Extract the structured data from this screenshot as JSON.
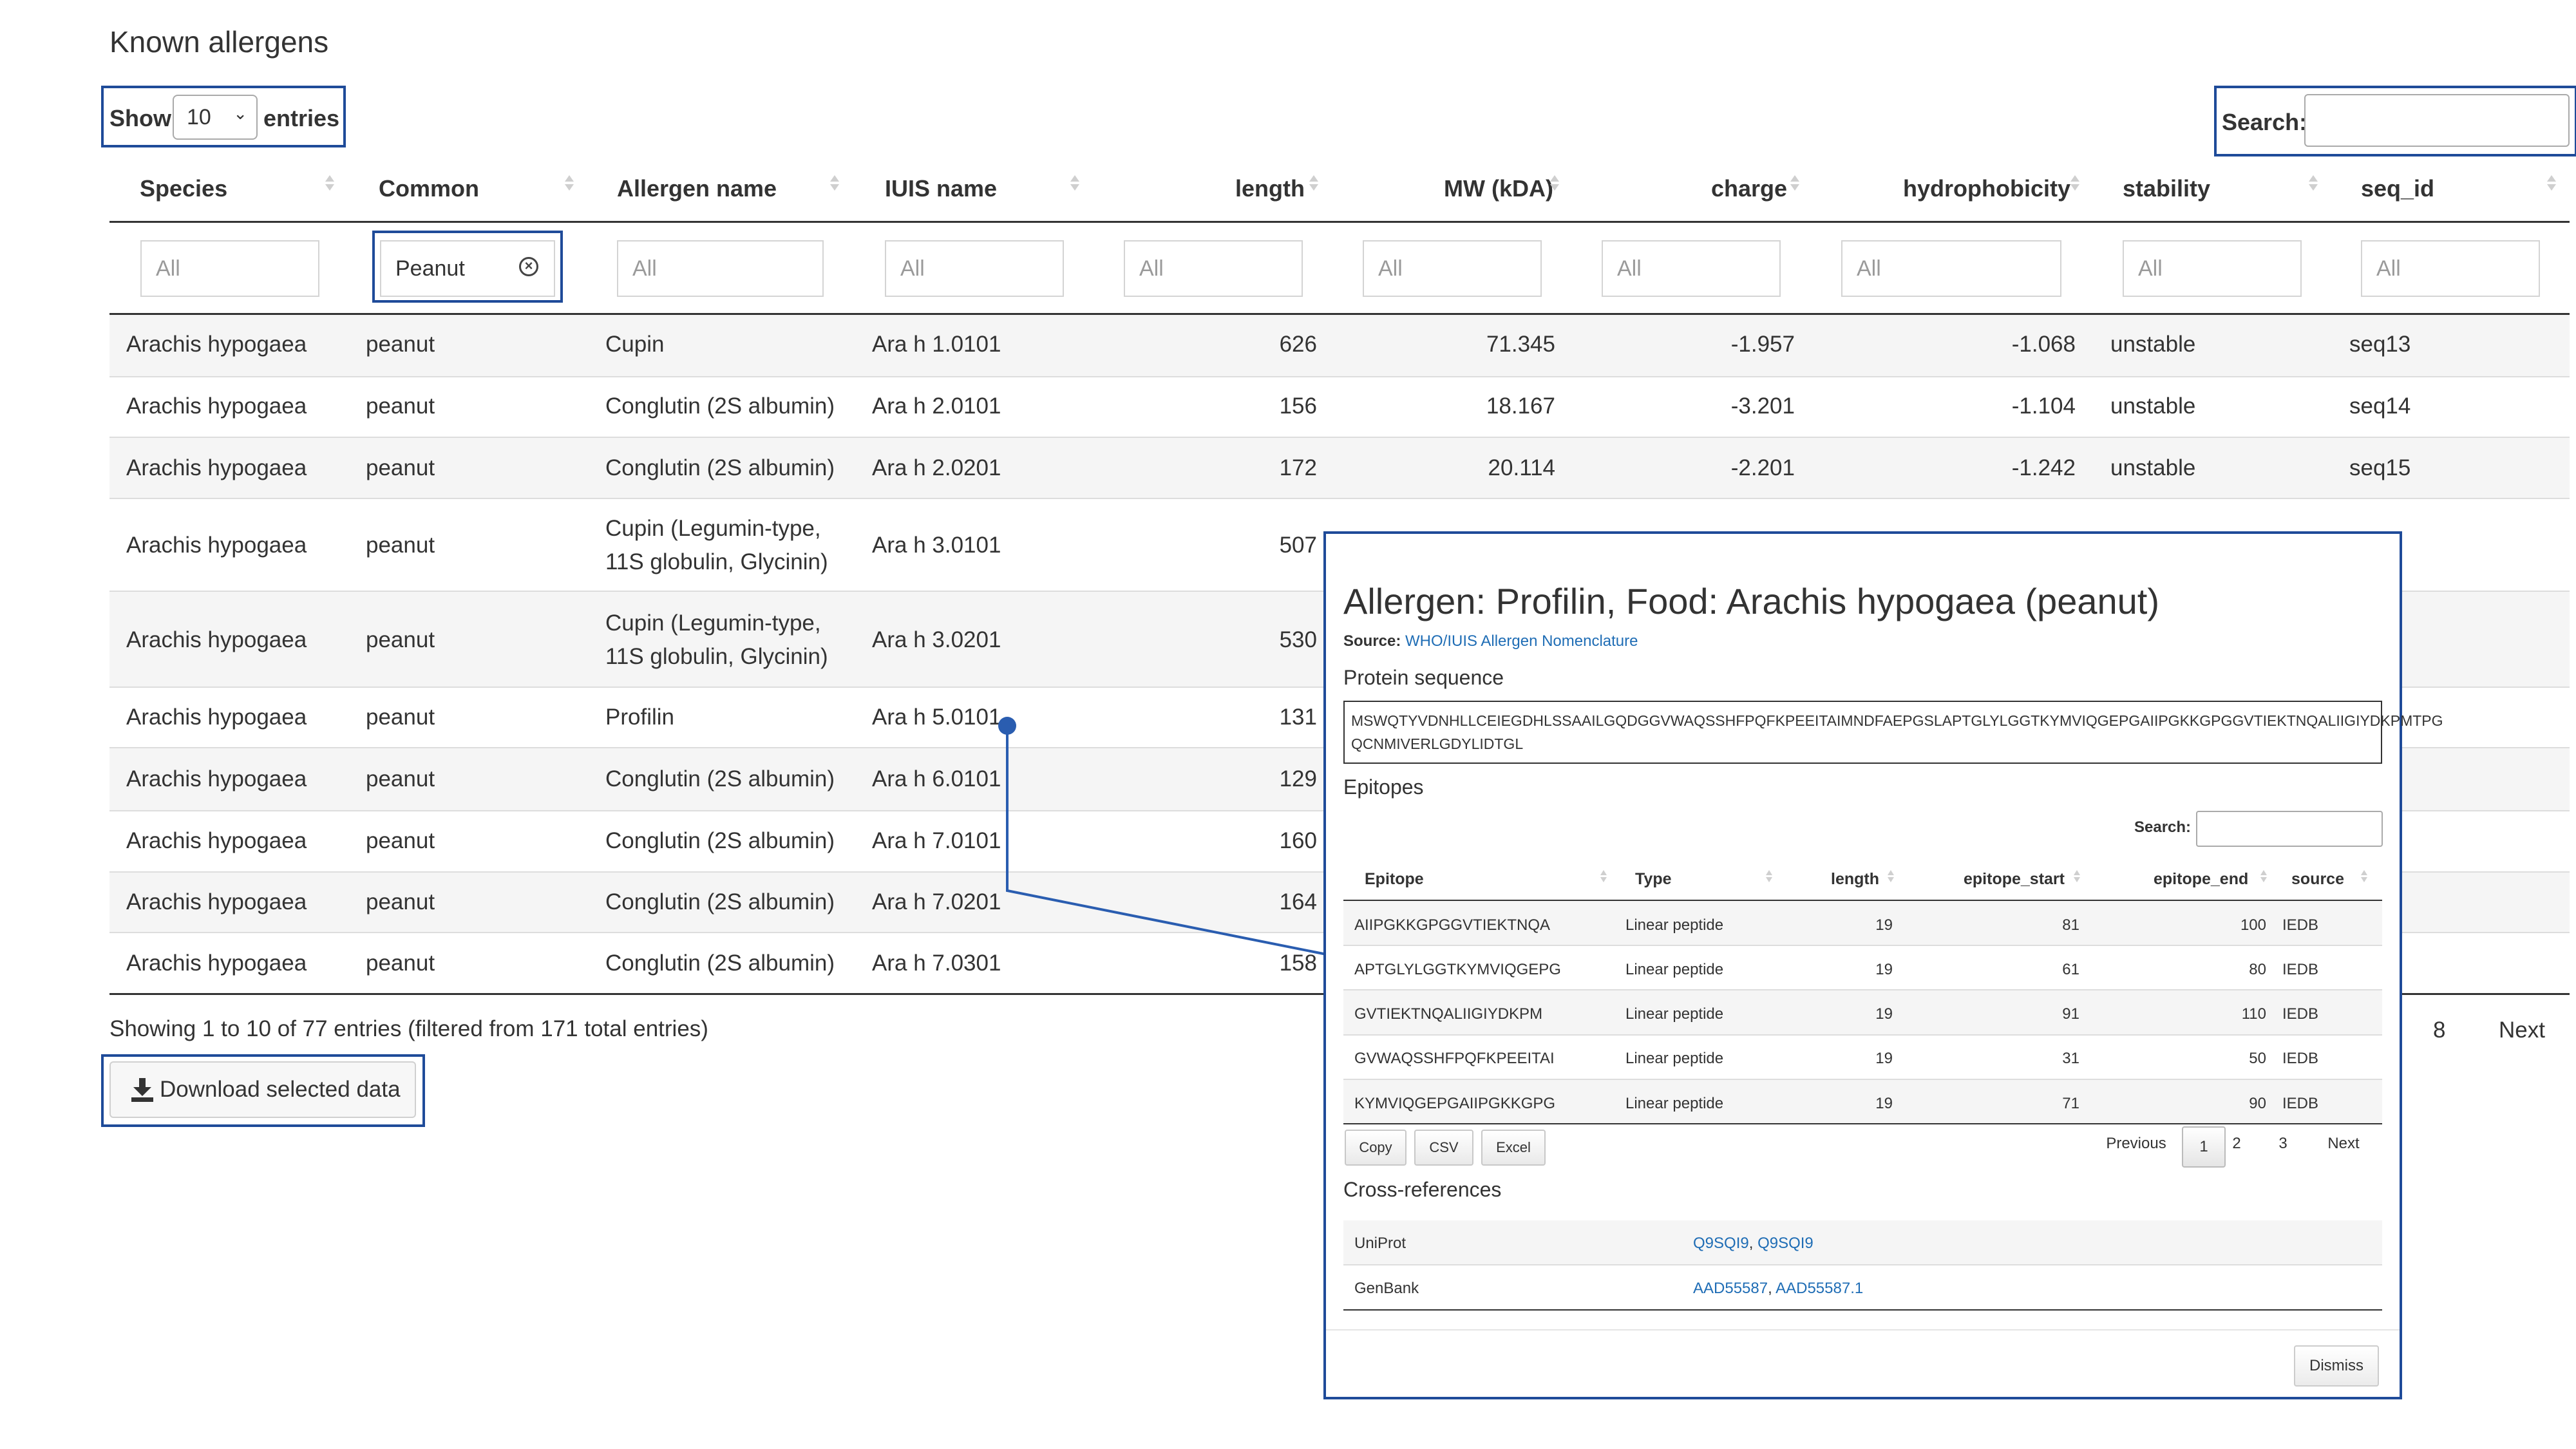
{
  "page": {
    "title": "Known allergens"
  },
  "length_control": {
    "show_label": "Show",
    "value": "10",
    "entries_label": "entries"
  },
  "search": {
    "label": "Search:",
    "value": ""
  },
  "table": {
    "headers": [
      "Species",
      "Common",
      "Allergen name",
      "IUIS name",
      "length",
      "MW (kDA)",
      "charge",
      "hydrophobicity",
      "stability",
      "seq_id"
    ],
    "filters": [
      "All",
      "Peanut",
      "All",
      "All",
      "All",
      "All",
      "All",
      "All",
      "All",
      "All"
    ],
    "rows": [
      {
        "species": "Arachis hypogaea",
        "common": "peanut",
        "allergen_l1": "Cupin",
        "allergen_l2": "",
        "iuis": "Ara h 1.0101",
        "length": "626",
        "mw": "71.345",
        "charge": "-1.957",
        "hydro": "-1.068",
        "stability": "unstable",
        "seq_id": "seq13"
      },
      {
        "species": "Arachis hypogaea",
        "common": "peanut",
        "allergen_l1": "Conglutin (2S albumin)",
        "allergen_l2": "",
        "iuis": "Ara h 2.0101",
        "length": "156",
        "mw": "18.167",
        "charge": "-3.201",
        "hydro": "-1.104",
        "stability": "unstable",
        "seq_id": "seq14"
      },
      {
        "species": "Arachis hypogaea",
        "common": "peanut",
        "allergen_l1": "Conglutin (2S albumin)",
        "allergen_l2": "",
        "iuis": "Ara h 2.0201",
        "length": "172",
        "mw": "20.114",
        "charge": "-2.201",
        "hydro": "-1.242",
        "stability": "unstable",
        "seq_id": "seq15"
      },
      {
        "species": "Arachis hypogaea",
        "common": "peanut",
        "allergen_l1": "Cupin (Legumin-type,",
        "allergen_l2": "11S globulin, Glycinin)",
        "iuis": "Ara h 3.0101",
        "length": "507",
        "mw": "",
        "charge": "",
        "hydro": "",
        "stability": "",
        "seq_id": ""
      },
      {
        "species": "Arachis hypogaea",
        "common": "peanut",
        "allergen_l1": "Cupin (Legumin-type,",
        "allergen_l2": "11S globulin, Glycinin)",
        "iuis": "Ara h 3.0201",
        "length": "530",
        "mw": "",
        "charge": "",
        "hydro": "",
        "stability": "",
        "seq_id": ""
      },
      {
        "species": "Arachis hypogaea",
        "common": "peanut",
        "allergen_l1": "Profilin",
        "allergen_l2": "",
        "iuis": "Ara h 5.0101",
        "length": "131",
        "mw": "",
        "charge": "",
        "hydro": "",
        "stability": "",
        "seq_id": ""
      },
      {
        "species": "Arachis hypogaea",
        "common": "peanut",
        "allergen_l1": "Conglutin (2S albumin)",
        "allergen_l2": "",
        "iuis": "Ara h 6.0101",
        "length": "129",
        "mw": "",
        "charge": "",
        "hydro": "",
        "stability": "",
        "seq_id": ""
      },
      {
        "species": "Arachis hypogaea",
        "common": "peanut",
        "allergen_l1": "Conglutin (2S albumin)",
        "allergen_l2": "",
        "iuis": "Ara h 7.0101",
        "length": "160",
        "mw": "",
        "charge": "",
        "hydro": "",
        "stability": "",
        "seq_id": ""
      },
      {
        "species": "Arachis hypogaea",
        "common": "peanut",
        "allergen_l1": "Conglutin (2S albumin)",
        "allergen_l2": "",
        "iuis": "Ara h 7.0201",
        "length": "164",
        "mw": "",
        "charge": "",
        "hydro": "",
        "stability": "",
        "seq_id": ""
      },
      {
        "species": "Arachis hypogaea",
        "common": "peanut",
        "allergen_l1": "Conglutin (2S albumin)",
        "allergen_l2": "",
        "iuis": "Ara h 7.0301",
        "length": "158",
        "mw": "",
        "charge": "",
        "hydro": "",
        "stability": "",
        "seq_id": ""
      }
    ]
  },
  "footer": {
    "info": "Showing 1 to 10 of 77 entries (filtered from 171 total entries)",
    "download_label": "Download selected data",
    "pager_last": "8",
    "pager_next": "Next"
  },
  "modal": {
    "title": "Allergen: Profilin, Food: Arachis hypogaea (peanut)",
    "source_label": "Source:",
    "source_link": "WHO/IUIS Allergen Nomenclature",
    "protein_heading": "Protein sequence",
    "sequence_line1": "MSWQTYVDNHLLCEIEGDHLSSAAILGQDGGVWAQSSHFPQFKPEEITAIMNDFAEPGSLAPTGLYLGGTKYMVIQGEPGAIIPGKKGPGGVTIEKTNQALIIGIYDKPMTPG",
    "sequence_line2": "QCNMIVERLGDYLIDTGL",
    "epitopes_heading": "Epitopes",
    "search_label": "Search:",
    "epitope_headers": [
      "Epitope",
      "Type",
      "length",
      "epitope_start",
      "epitope_end",
      "source"
    ],
    "epitopes": [
      {
        "epitope": "AIIPGKKGPGGVTIEKTNQA",
        "type": "Linear peptide",
        "length": "19",
        "start": "81",
        "end": "100",
        "source": "IEDB"
      },
      {
        "epitope": "APTGLYLGGTKYMVIQGEPG",
        "type": "Linear peptide",
        "length": "19",
        "start": "61",
        "end": "80",
        "source": "IEDB"
      },
      {
        "epitope": "GVTIEKTNQALIIGIYDKPM",
        "type": "Linear peptide",
        "length": "19",
        "start": "91",
        "end": "110",
        "source": "IEDB"
      },
      {
        "epitope": "GVWAQSSHFPQFKPEEITAI",
        "type": "Linear peptide",
        "length": "19",
        "start": "31",
        "end": "50",
        "source": "IEDB"
      },
      {
        "epitope": "KYMVIQGEPGAIIPGKKGPG",
        "type": "Linear peptide",
        "length": "19",
        "start": "71",
        "end": "90",
        "source": "IEDB"
      }
    ],
    "buttons": {
      "copy": "Copy",
      "csv": "CSV",
      "excel": "Excel"
    },
    "pager": {
      "previous": "Previous",
      "p1": "1",
      "p2": "2",
      "p3": "3",
      "next": "Next"
    },
    "xref_heading": "Cross-references",
    "xrefs": [
      {
        "db": "UniProt",
        "link1": "Q9SQI9",
        "sep": ",",
        "link2": "Q9SQI9"
      },
      {
        "db": "GenBank",
        "link1": "AAD55587",
        "sep": ",",
        "link2": "AAD55587.1"
      }
    ],
    "dismiss_label": "Dismiss"
  },
  "colors": {
    "accent_outline": "#1f4b99",
    "link": "#1f6db5",
    "stripe": "#f5f5f5"
  },
  "icons": {
    "clear": "clear-circle-icon",
    "download": "download-icon",
    "sort": "sort-arrows-icon",
    "select_caret": "chevron-down-icon"
  }
}
